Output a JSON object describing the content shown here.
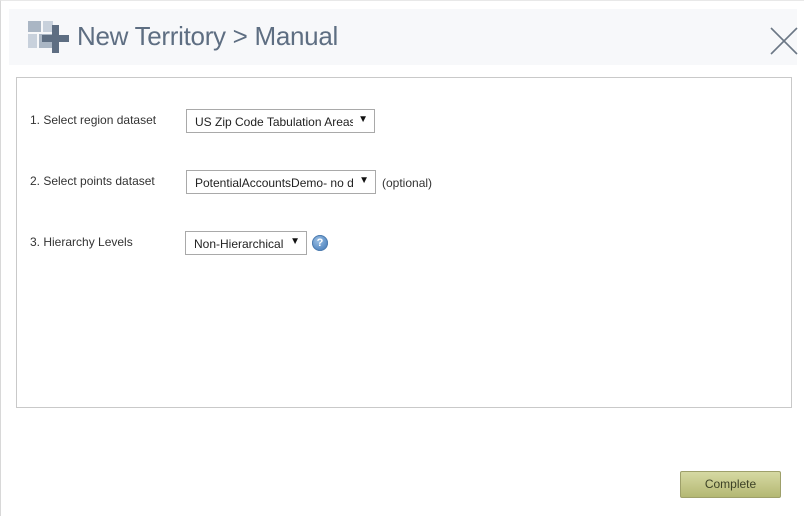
{
  "header": {
    "title": "New Territory > Manual",
    "icon": "territory-add-icon",
    "close_icon": "close-icon"
  },
  "form": {
    "region": {
      "label": "1. Select region dataset",
      "value": "US Zip Code Tabulation Areas"
    },
    "points": {
      "label": "2. Select points dataset",
      "value": "PotentialAccountsDemo- no data",
      "optional": "(optional)"
    },
    "hierarchy": {
      "label": "3. Hierarchy Levels",
      "value": "Non-Hierarchical",
      "help": "?"
    },
    "dropdown_arrow": "▼"
  },
  "footer": {
    "complete_label": "Complete"
  },
  "colors": {
    "title": "#5e6e82",
    "header_bg": "#f7f8fa",
    "button_top": "#d6d9a3",
    "button_bottom": "#b4b873",
    "help_blue": "#5d8fc6"
  }
}
